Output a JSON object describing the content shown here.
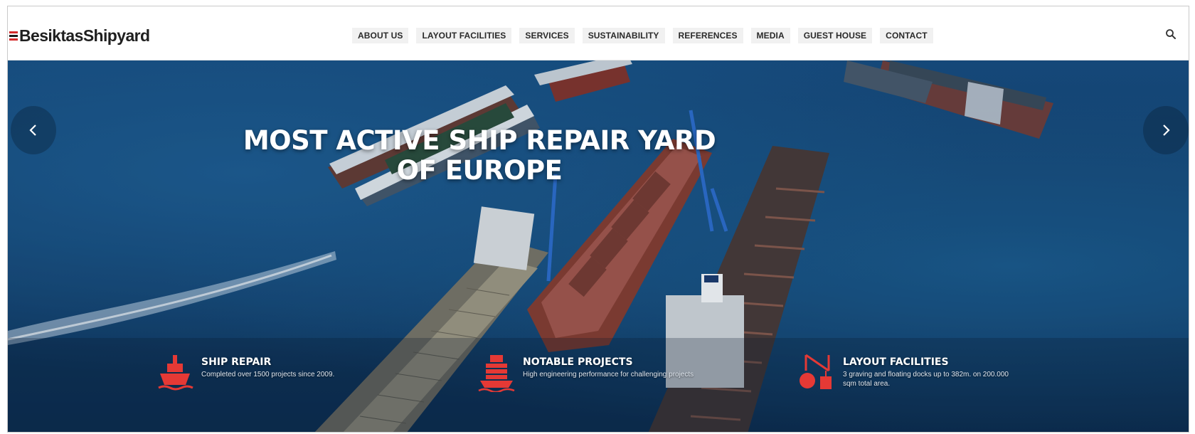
{
  "brand": {
    "name": "BesiktasShipyard",
    "accent": "#d42a2a"
  },
  "nav": {
    "items": [
      {
        "label": "ABOUT US"
      },
      {
        "label": "LAYOUT FACILITIES"
      },
      {
        "label": "SERVICES"
      },
      {
        "label": "SUSTAINABILITY"
      },
      {
        "label": "REFERENCES"
      },
      {
        "label": "MEDIA"
      },
      {
        "label": "GUEST HOUSE"
      },
      {
        "label": "CONTACT"
      }
    ],
    "search_icon": "search-icon"
  },
  "hero": {
    "title_line1": "MOST ACTIVE SHIP REPAIR YARD",
    "title_line2": "OF EUROPE",
    "prev_icon": "chevron-left-icon",
    "next_icon": "chevron-right-icon"
  },
  "features": [
    {
      "icon": "ship-icon",
      "title": "SHIP REPAIR",
      "desc": "Completed over 1500 projects since 2009."
    },
    {
      "icon": "container-ship-icon",
      "title": "NOTABLE PROJECTS",
      "desc": "High engineering performance for challenging projects"
    },
    {
      "icon": "crane-icon",
      "title": "LAYOUT FACILITIES",
      "desc": "3 graving and floating docks up to 382m. on 200.000 sqm total area."
    }
  ]
}
